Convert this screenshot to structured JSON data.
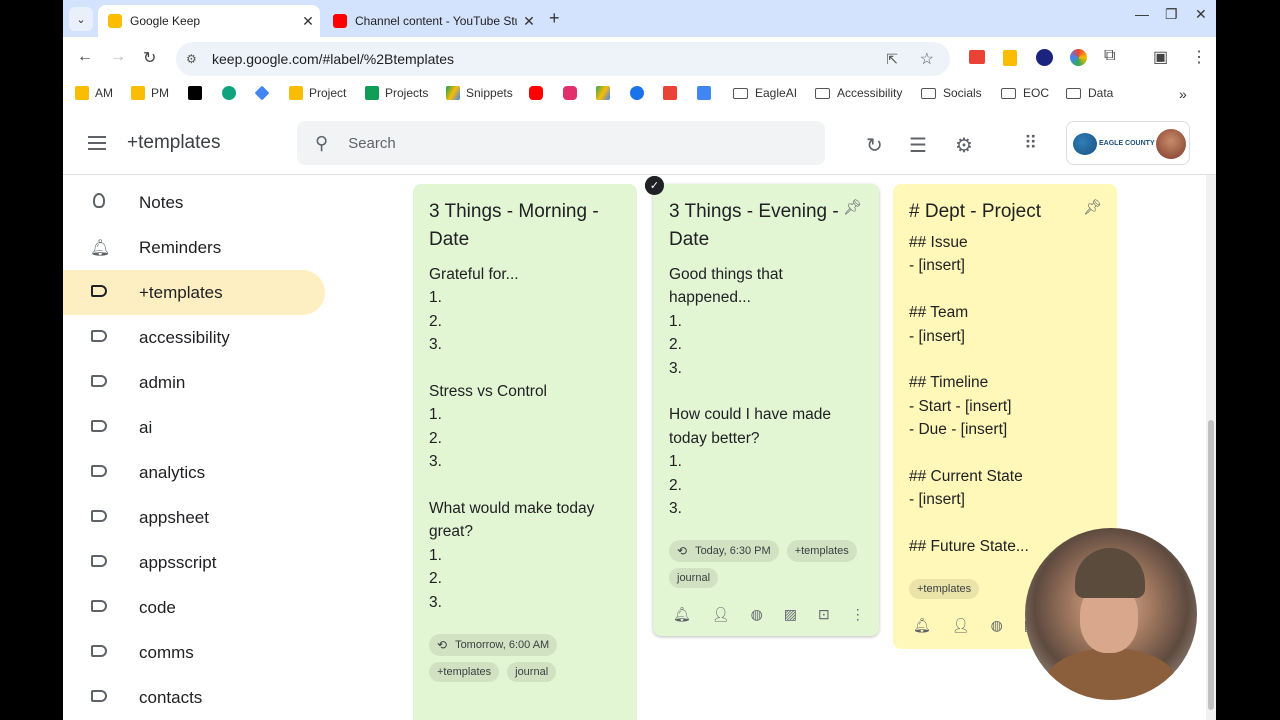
{
  "browser": {
    "tabs": [
      {
        "title": "Google Keep",
        "active": true,
        "favicon_color": "#fbbc04"
      },
      {
        "title": "Channel content - YouTube Stu",
        "active": false,
        "favicon_color": "#ff0000"
      }
    ],
    "url": "keep.google.com/#label/%2Btemplates",
    "bookmarks": [
      {
        "label": "AM",
        "icon": "keep-icon",
        "color": "#fbbc04"
      },
      {
        "label": "PM",
        "icon": "keep-icon",
        "color": "#fbbc04"
      },
      {
        "label": "",
        "icon": "x-icon",
        "color": "#000000"
      },
      {
        "label": "",
        "icon": "chatgpt-icon",
        "color": "#10a37f"
      },
      {
        "label": "",
        "icon": "gemini-icon",
        "color": "#4285f4"
      },
      {
        "label": "Project",
        "icon": "keep-icon",
        "color": "#fbbc04"
      },
      {
        "label": "Projects",
        "icon": "sheets-icon",
        "color": "#0f9d58"
      },
      {
        "label": "Snippets",
        "icon": "drive-icon",
        "color": "#4285f4"
      },
      {
        "label": "",
        "icon": "youtube-icon",
        "color": "#ff0000"
      },
      {
        "label": "",
        "icon": "instagram-icon",
        "color": "#e1306c"
      },
      {
        "label": "",
        "icon": "drive-icon",
        "color": "#34a853"
      },
      {
        "label": "",
        "icon": "meet-icon",
        "color": "#1a73e8"
      },
      {
        "label": "",
        "icon": "gmail-icon",
        "color": "#ea4335"
      },
      {
        "label": "",
        "icon": "calendar-icon",
        "color": "#4285f4"
      },
      {
        "label": "EagleAI",
        "icon": "folder-icon",
        "color": "#555555"
      },
      {
        "label": "Accessibility",
        "icon": "folder-icon",
        "color": "#555555"
      },
      {
        "label": "Socials",
        "icon": "folder-icon",
        "color": "#555555"
      },
      {
        "label": "EOC",
        "icon": "folder-icon",
        "color": "#555555"
      },
      {
        "label": "Data",
        "icon": "folder-icon",
        "color": "#555555"
      }
    ]
  },
  "keep": {
    "title": "+templates",
    "search_placeholder": "Search",
    "account_org": "EAGLE COUNTY"
  },
  "sidebar": {
    "items": [
      {
        "label": "Notes",
        "icon": "lightbulb-icon",
        "active": false
      },
      {
        "label": "Reminders",
        "icon": "bell-icon",
        "active": false
      },
      {
        "label": "+templates",
        "icon": "label-icon",
        "active": true
      },
      {
        "label": "accessibility",
        "icon": "label-icon",
        "active": false
      },
      {
        "label": "admin",
        "icon": "label-icon",
        "active": false
      },
      {
        "label": "ai",
        "icon": "label-icon",
        "active": false
      },
      {
        "label": "analytics",
        "icon": "label-icon",
        "active": false
      },
      {
        "label": "appsheet",
        "icon": "label-icon",
        "active": false
      },
      {
        "label": "appsscript",
        "icon": "label-icon",
        "active": false
      },
      {
        "label": "code",
        "icon": "label-icon",
        "active": false
      },
      {
        "label": "comms",
        "icon": "label-icon",
        "active": false
      },
      {
        "label": "contacts",
        "icon": "label-icon",
        "active": false
      }
    ]
  },
  "notes": [
    {
      "title": "3 Things - Morning - Date",
      "body": "Grateful for...\n1.\n2.\n3.\n\nStress vs Control\n1.\n2.\n3.\n\nWhat would make today great?\n1.\n2.\n3.",
      "reminder": "Tomorrow, 6:00 AM",
      "labels": [
        "+templates",
        "journal"
      ],
      "color": "#e2f6d3"
    },
    {
      "title": "3 Things - Evening - Date",
      "body": "Good things that happened...\n1.\n2.\n3.\n\nHow could I have made today better?\n1.\n2.\n3.",
      "reminder": "Today, 6:30 PM",
      "labels": [
        "+templates",
        "journal"
      ],
      "color": "#e2f6d3"
    },
    {
      "title": "# Dept - Project",
      "body": "## Issue\n- [insert]\n\n## Team\n- [insert]\n\n## Timeline\n- Start - [insert]\n- Due - [insert]\n\n## Current State\n- [insert]\n\n## Future State...",
      "labels": [
        "+templates"
      ],
      "color": "#fff8b8"
    }
  ]
}
